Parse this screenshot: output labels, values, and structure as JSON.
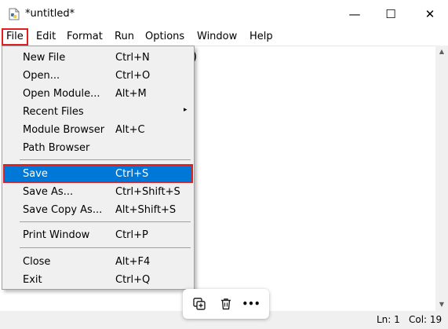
{
  "window": {
    "title": "*untitled*",
    "controls": {
      "minimize": "—",
      "maximize": "☐",
      "close": "✕"
    }
  },
  "menubar": {
    "items": [
      {
        "label": "File"
      },
      {
        "label": "Edit"
      },
      {
        "label": "Format"
      },
      {
        "label": "Run"
      },
      {
        "label": "Options"
      },
      {
        "label": "Window"
      },
      {
        "label": "Help"
      }
    ]
  },
  "editor": {
    "text": ")"
  },
  "file_menu": {
    "items": [
      {
        "label": "New File",
        "accel": "Ctrl+N"
      },
      {
        "label": "Open...",
        "accel": "Ctrl+O"
      },
      {
        "label": "Open Module...",
        "accel": "Alt+M"
      },
      {
        "label": "Recent Files",
        "accel": "",
        "submenu_arrow": "▸"
      },
      {
        "label": "Module Browser",
        "accel": "Alt+C"
      },
      {
        "label": "Path Browser",
        "accel": ""
      },
      {
        "label": "Save",
        "accel": "Ctrl+S"
      },
      {
        "label": "Save As...",
        "accel": "Ctrl+Shift+S"
      },
      {
        "label": "Save Copy As...",
        "accel": "Alt+Shift+S"
      },
      {
        "label": "Print Window",
        "accel": "Ctrl+P"
      },
      {
        "label": "Close",
        "accel": "Alt+F4"
      },
      {
        "label": "Exit",
        "accel": "Ctrl+Q"
      }
    ]
  },
  "statusbar": {
    "line": "Ln: 1",
    "col": "Col: 19"
  },
  "floating_toolbar": {
    "more": "•••"
  },
  "colors": {
    "highlight": "#0078d7",
    "annotation": "#e02020"
  }
}
